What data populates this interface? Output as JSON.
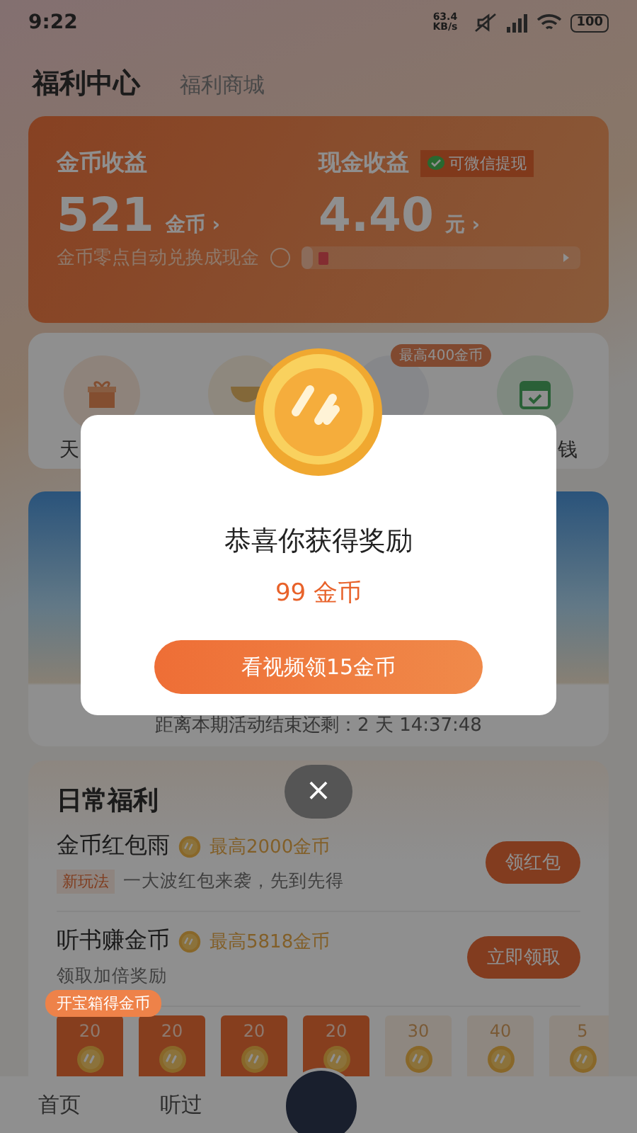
{
  "status_bar": {
    "time": "9:22",
    "speed": "63.4\nKB/s",
    "battery": "100"
  },
  "header": {
    "tabs": [
      {
        "label": "福利中心",
        "selected": true
      },
      {
        "label": "福利商城",
        "selected": false
      }
    ]
  },
  "earnings": {
    "coins": {
      "title": "金币收益",
      "amount": "521",
      "unit": "金币 ›"
    },
    "cash": {
      "title": "现金收益",
      "badge": "可微信提现",
      "amount": "4.40",
      "unit": "元 ›"
    },
    "note": "金币零点自动兑换成现金",
    "progress": {
      "level": 0.04
    }
  },
  "shortcuts": [
    {
      "label": "天",
      "kind": "gift"
    },
    {
      "kind": "bowl"
    },
    {
      "kind": "blank",
      "badge": "最高400金币"
    },
    {
      "label": "钱",
      "kind": "calendar"
    }
  ],
  "banner": {
    "countdown": "距离本期活动结束还剩：2 天 14:37:48"
  },
  "daily": {
    "title": "日常福利",
    "tasks": [
      {
        "title": "金币红包雨",
        "reward": "最高2000金币",
        "tag": "新玩法",
        "desc": "一大波红包来袭，先到先得",
        "button": "领红包"
      },
      {
        "title": "听书赚金币",
        "reward": "最高5818金币",
        "desc": "领取加倍奖励",
        "button": "立即领取"
      }
    ],
    "chest_label": "开宝箱得金币",
    "tiles": [
      {
        "amount": "20",
        "claimed": true
      },
      {
        "amount": "20",
        "claimed": true
      },
      {
        "amount": "20",
        "claimed": true
      },
      {
        "amount": "20",
        "claimed": true
      },
      {
        "amount": "30",
        "claimed": false
      },
      {
        "amount": "40",
        "claimed": false
      },
      {
        "amount": "5",
        "claimed": false
      }
    ]
  },
  "bottom_nav": [
    {
      "label": "首页"
    },
    {
      "label": "听过"
    }
  ],
  "modal": {
    "title": "恭喜你获得奖励",
    "reward": "99 金币",
    "button": "看视频领15金币",
    "close": "×"
  }
}
